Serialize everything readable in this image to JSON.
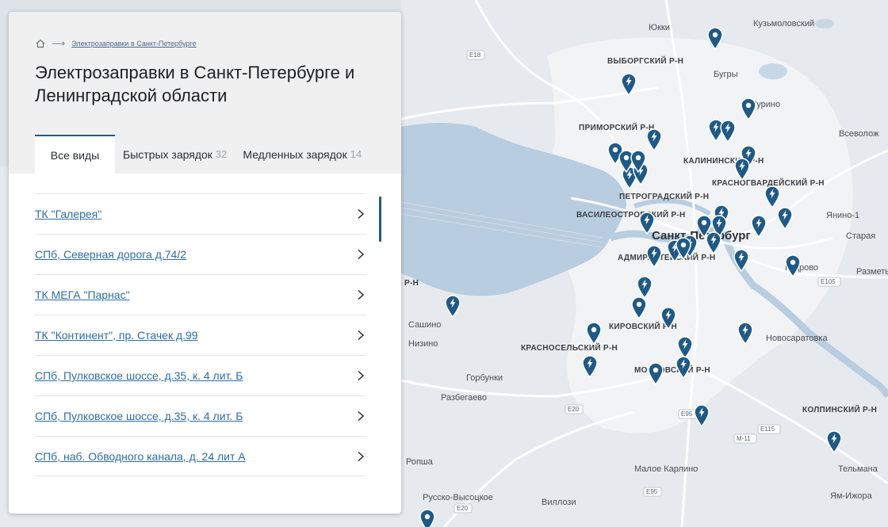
{
  "panel": {
    "breadcrumb_link": "Электрозаправки в Санкт-Петербурге",
    "title": "Электрозаправки в Санкт-Петербурге и Ленинградской области",
    "tabs": [
      {
        "label": "Все виды",
        "count": ""
      },
      {
        "label": "Быстрых зарядок",
        "count": "32"
      },
      {
        "label": "Медленных зарядок",
        "count": "14"
      }
    ],
    "items": [
      {
        "label": "ТК \"Галерея\""
      },
      {
        "label": "СПб, Северная дорога д.74/2"
      },
      {
        "label": "ТК МЕГА \"Парнас\""
      },
      {
        "label": "ТК \"Континент\", пр. Стачек д.99"
      },
      {
        "label": "СПб, Пулковское шоссе, д.35, к. 4 лит. Б"
      },
      {
        "label": "СПб, Пулковское шоссе, д.35, к. 4 лит. Б"
      },
      {
        "label": "СПб, наб. Обводного канала, д. 24 лит А"
      }
    ]
  },
  "map": {
    "city": "Санкт-Петербург",
    "places": [
      "Юкки",
      "Кузьмоловский",
      "Бугры",
      "Мурино",
      "Всеволож",
      "Янино-1",
      "Старая",
      "Кудрово",
      "Разметь",
      "Сашино",
      "Низино",
      "Горбунки",
      "Разбегаево",
      "Новосаратовка",
      "Ропша",
      "Малое Карлино",
      "Русско-Высоцкое",
      "Виллози",
      "Тельмана",
      "Ям-Ижора"
    ],
    "districts": [
      "ВЫБОРГСКИЙ Р-Н",
      "ПРИМОРСКИЙ Р-Н",
      "КАЛИНИНСКИЙ Р-Н",
      "ПЕТРОГРАДСКИЙ Р-Н",
      "КРАСНОГВАРДЕЙСКИЙ Р-Н",
      "ВАСИЛЕОСТРОВСКИЙ Р-Н",
      "АДМИРАЛТЕЙСКИЙ Р-Н",
      "КИРОВСКИЙ Р-Н",
      "КРАСНОСЕЛЬСКИЙ Р-Н",
      "МОСКОВСКИЙ Р-Н",
      "КОЛПИНСКИЙ Р-Н",
      "Р-Н"
    ],
    "roads": [
      "E18",
      "E20",
      "E95",
      "E105",
      "E115",
      "M-11"
    ],
    "colors": {
      "marker": "#1f5a86",
      "water": "#b9cde0",
      "land": "#e6eaee",
      "urban": "#f3f4f6"
    }
  }
}
